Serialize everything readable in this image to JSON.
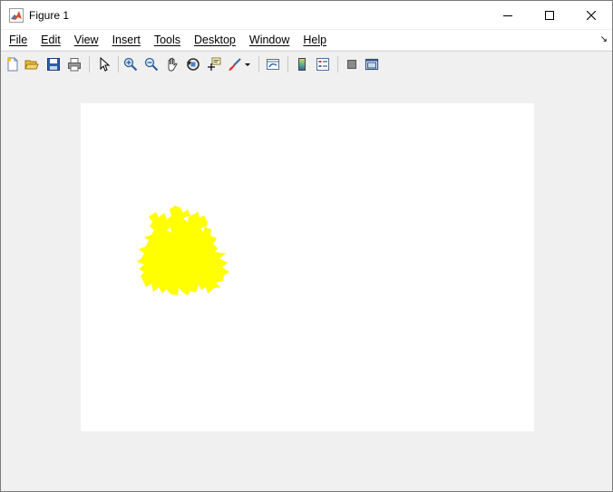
{
  "window": {
    "title": "Figure 1",
    "icons": {
      "app": "matlab-logo-icon",
      "minimize": "minimize-icon",
      "maximize": "maximize-icon",
      "close": "close-icon"
    }
  },
  "menubar": {
    "items": [
      "File",
      "Edit",
      "View",
      "Insert",
      "Tools",
      "Desktop",
      "Window",
      "Help"
    ],
    "dock_icon": "dock-arrow-icon"
  },
  "toolbar": {
    "buttons": [
      "new-figure-icon",
      "open-file-icon",
      "save-icon",
      "print-icon",
      "pointer-icon",
      "zoom-in-icon",
      "zoom-out-icon",
      "pan-hand-icon",
      "rotate-3d-icon",
      "data-cursor-icon",
      "brush-icon",
      "link-plot-icon",
      "colorbar-icon",
      "legend-icon",
      "hide-plot-tools-icon",
      "show-plot-tools-icon"
    ]
  },
  "figure": {
    "background_color": "#f0f0f0",
    "axes_color": "#ffffff",
    "blob_color": "#ffff00"
  }
}
